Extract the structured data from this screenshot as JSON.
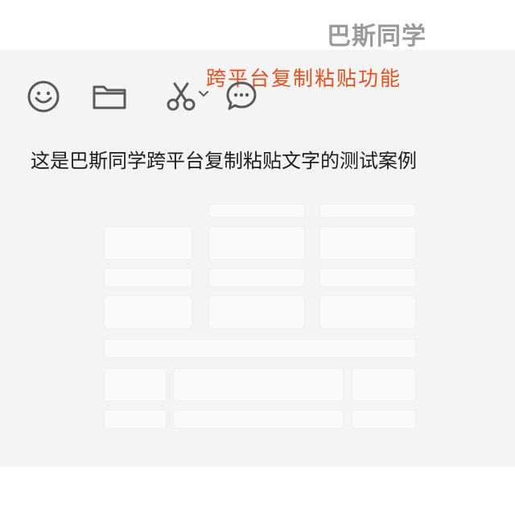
{
  "watermark": {
    "text": "巴斯同学"
  },
  "caption": {
    "text": "跨平台复制粘贴功能",
    "color": "#e8501e"
  },
  "toolbar": {
    "icons": [
      {
        "name": "emoji-icon"
      },
      {
        "name": "folder-icon"
      },
      {
        "name": "scissors-icon"
      },
      {
        "name": "chat-bubble-icon"
      }
    ]
  },
  "message": {
    "text": "这是巴斯同学跨平台复制粘贴文字的测试案例"
  },
  "colors": {
    "panel_background": "#f4f4f4",
    "icon_stroke": "#5a5a5a",
    "text": "#1e1e1e"
  }
}
